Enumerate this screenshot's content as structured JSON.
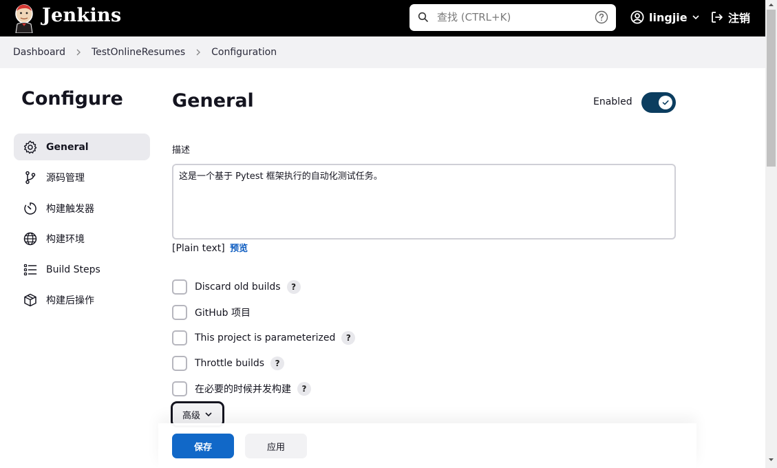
{
  "header": {
    "brand": "Jenkins",
    "search_placeholder": "查找 (CTRL+K)",
    "user_name": "lingjie",
    "logout_label": "注销"
  },
  "breadcrumb": [
    "Dashboard",
    "TestOnlineResumes",
    "Configuration"
  ],
  "sidebar": {
    "title": "Configure",
    "items": [
      {
        "label": "General",
        "icon": "gear-icon",
        "active": true
      },
      {
        "label": "源码管理",
        "icon": "branch-icon",
        "active": false
      },
      {
        "label": "构建触发器",
        "icon": "timer-icon",
        "active": false
      },
      {
        "label": "构建环境",
        "icon": "globe-icon",
        "active": false
      },
      {
        "label": "Build Steps",
        "icon": "list-icon",
        "active": false
      },
      {
        "label": "构建后操作",
        "icon": "package-icon",
        "active": false
      }
    ]
  },
  "main": {
    "title": "General",
    "enabled_label": "Enabled",
    "enabled": true,
    "description_label": "描述",
    "description_value": "这是一个基于 Pytest 框架执行的自动化测试任务。",
    "plain_text": "[Plain text]",
    "preview_label": "预览",
    "options": [
      {
        "label": "Discard old builds",
        "help": true,
        "checked": false
      },
      {
        "label": "GitHub 项目",
        "help": false,
        "checked": false
      },
      {
        "label": "This project is parameterized",
        "help": true,
        "checked": false
      },
      {
        "label": "Throttle builds",
        "help": true,
        "checked": false
      },
      {
        "label": "在必要的时候并发构建",
        "help": true,
        "checked": false
      }
    ],
    "help_mark": "?",
    "advanced_label": "高级"
  },
  "footer": {
    "save_label": "保存",
    "apply_label": "应用"
  },
  "colors": {
    "header_bg": "#000000",
    "toggle_on": "#0b3d5f",
    "save_button": "#1168c8",
    "link": "#0d5cc0"
  }
}
